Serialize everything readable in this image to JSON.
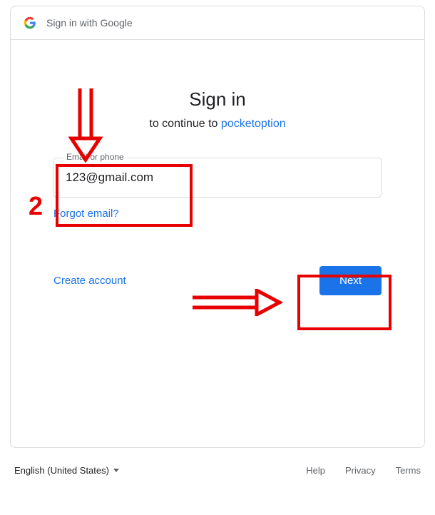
{
  "header": {
    "title": "Sign in with Google"
  },
  "signin": {
    "title": "Sign in",
    "subtitle_prefix": "to continue to ",
    "app_name": "pocketoption"
  },
  "email_field": {
    "label": "Email or phone",
    "value": "123@gmail.com"
  },
  "links": {
    "forgot": "Forgot email?",
    "create": "Create account"
  },
  "buttons": {
    "next": "Next"
  },
  "footer": {
    "language": "English (United States)",
    "help": "Help",
    "privacy": "Privacy",
    "terms": "Terms"
  },
  "annotations": {
    "step_number": "2"
  }
}
